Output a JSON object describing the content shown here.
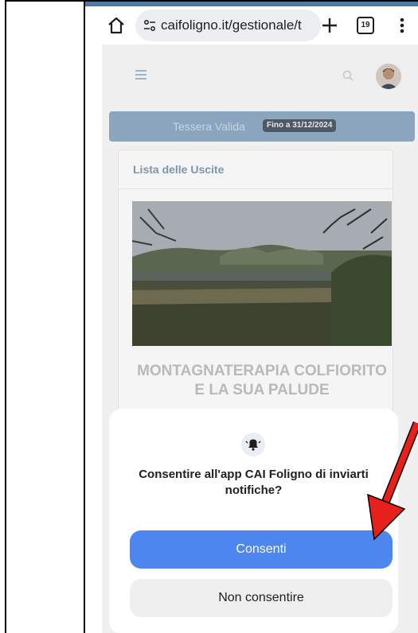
{
  "browser": {
    "url": "caifoligno.it/gestionale/t",
    "tab_count": "19",
    "icons": [
      "home-icon",
      "site-info-icon",
      "new-tab-plus-icon",
      "tab-switcher-icon",
      "overflow-menu-icon"
    ]
  },
  "site": {
    "membership_status": "Tessera Valida",
    "membership_expiry": "Fino a 31/12/2024",
    "card_title": "Lista delle Uscite",
    "excursion_title": "MONTAGNATERAPIA COLFIORITO E LA SUA PALUDE"
  },
  "dialog": {
    "message": "Consentire all'app CAI Foligno di inviarti notifiche?",
    "allow_label": "Consenti",
    "deny_label": "Non consentire"
  },
  "colors": {
    "allow_button": "#4c86ee",
    "annotation_arrow": "#e8201c",
    "banner": "#8aa5bd"
  }
}
